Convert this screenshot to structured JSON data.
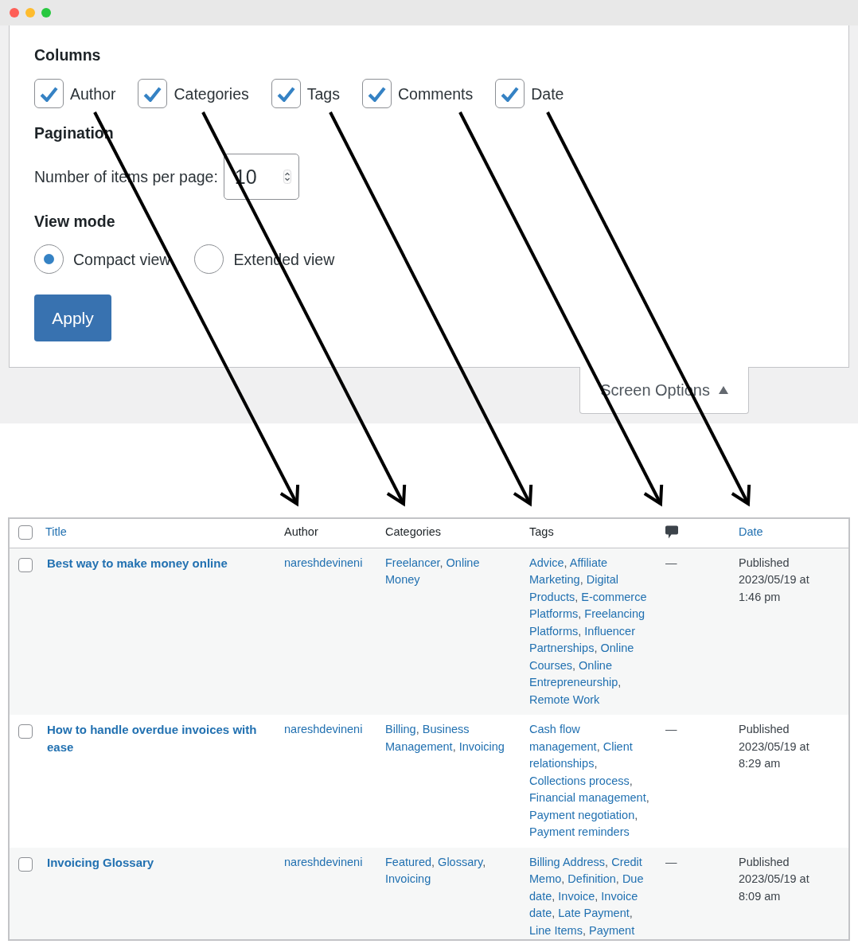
{
  "screen_options": {
    "columns_heading": "Columns",
    "columns": [
      {
        "label": "Author",
        "checked": true
      },
      {
        "label": "Categories",
        "checked": true
      },
      {
        "label": "Tags",
        "checked": true
      },
      {
        "label": "Comments",
        "checked": true
      },
      {
        "label": "Date",
        "checked": true
      }
    ],
    "pagination_heading": "Pagination",
    "items_per_page": {
      "label": "Number of items per page:",
      "value": "10"
    },
    "view_mode_heading": "View mode",
    "view_modes": [
      {
        "label": "Compact view",
        "selected": true
      },
      {
        "label": "Extended view",
        "selected": false
      }
    ],
    "apply_button": "Apply"
  },
  "screen_options_tab": {
    "label": "Screen Options",
    "expanded": true
  },
  "table": {
    "select_all": {
      "checked": false
    },
    "columns": [
      {
        "kind": "sortable",
        "label": "Title"
      },
      {
        "kind": "plain",
        "label": "Author"
      },
      {
        "kind": "plain",
        "label": "Categories"
      },
      {
        "kind": "plain",
        "label": "Tags"
      },
      {
        "kind": "icon"
      },
      {
        "kind": "sortable",
        "label": "Date"
      }
    ],
    "separator": ",",
    "rows": [
      {
        "selected": false,
        "title": "Best way to make money online",
        "author": "nareshdevineni",
        "categories": [
          "Freelancer",
          "Online Money"
        ],
        "tags": [
          "Advice",
          "Affiliate Marketing",
          "Digital Products",
          "E-commerce Platforms",
          "Freelancing Platforms",
          "Influencer Partnerships",
          "Online Courses",
          "Online Entrepreneurship",
          "Remote Work"
        ],
        "comments": "—",
        "status": "Published",
        "date": "2023/05/19 at 1:46 pm"
      },
      {
        "selected": false,
        "title": "How to handle overdue invoices with ease",
        "author": "nareshdevineni",
        "categories": [
          "Billing",
          "Business Management",
          "Invoicing"
        ],
        "tags": [
          "Cash flow management",
          "Client relationships",
          "Collections process",
          "Financial management",
          "Payment negotiation",
          "Payment reminders"
        ],
        "comments": "—",
        "status": "Published",
        "date": "2023/05/19 at 8:29 am"
      },
      {
        "selected": false,
        "title": "Invoicing Glossary",
        "author": "nareshdevineni",
        "categories": [
          "Featured",
          "Glossary",
          "Invoicing"
        ],
        "tags": [
          "Billing Address",
          "Credit Memo",
          "Definition",
          "Due date",
          "Invoice",
          "Invoice date",
          "Late Payment",
          "Line Items",
          "Payment"
        ],
        "comments": "—",
        "status": "Published",
        "date": "2023/05/19 at 8:09 am"
      }
    ]
  }
}
